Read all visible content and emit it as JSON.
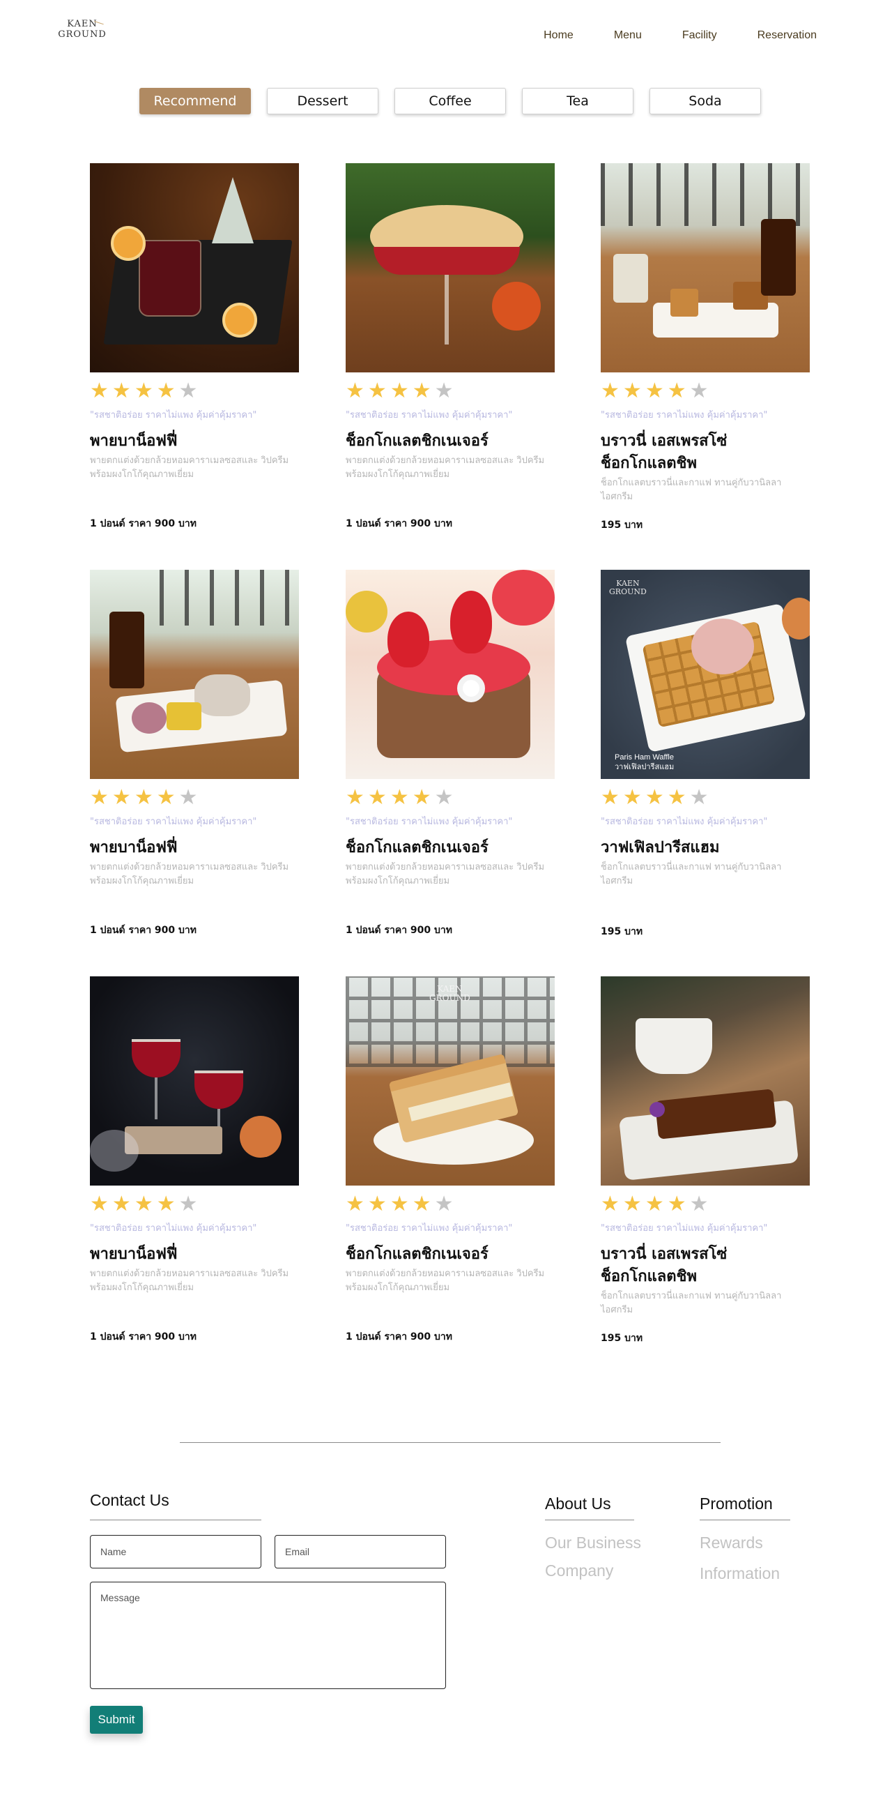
{
  "brand": {
    "line1": "KAEN",
    "line2": "GROUND"
  },
  "nav": [
    "Home",
    "Menu",
    "Facility",
    "Reservation"
  ],
  "tabs": [
    {
      "label": "Recommend",
      "active": true
    },
    {
      "label": "Dessert",
      "active": false
    },
    {
      "label": "Coffee",
      "active": false
    },
    {
      "label": "Tea",
      "active": false
    },
    {
      "label": "Soda",
      "active": false
    }
  ],
  "products": [
    {
      "rating": 4,
      "tagline": "\"รสชาติอร่อย ราคาไม่แพง คุ้มค่าคุ้มราคา\"",
      "name": "พายบาน็อฟฟี่",
      "desc": "พายตกแต่งด้วยกล้วยหอมคาราเมลซอสและ วิปครีม พร้อมผงโกโก้คุณภาพเยี่ยม",
      "price": "1 ปอนด์ ราคา 900 บาท"
    },
    {
      "rating": 4,
      "tagline": "\"รสชาติอร่อย ราคาไม่แพง คุ้มค่าคุ้มราคา\"",
      "name": "ช็อกโกแลตชิกเนเจอร์",
      "desc": "พายตกแต่งด้วยกล้วยหอมคาราเมลซอสและ วิปครีม พร้อมผงโกโก้คุณภาพเยี่ยม",
      "price": "1 ปอนด์ ราคา 900 บาท"
    },
    {
      "rating": 4,
      "tagline": "\"รสชาติอร่อย ราคาไม่แพง คุ้มค่าคุ้มราคา\"",
      "name": "บราวนี่ เอสเพรสโซ่ ช็อกโกแลตชิพ",
      "desc": "ช็อกโกแลตบราวนี่และกาแฟ ทานคู่กับวานิลลาไอศกรีม",
      "price": "195 บาท"
    },
    {
      "rating": 4,
      "tagline": "\"รสชาติอร่อย ราคาไม่แพง คุ้มค่าคุ้มราคา\"",
      "name": "พายบาน็อฟฟี่",
      "desc": "พายตกแต่งด้วยกล้วยหอมคาราเมลซอสและ วิปครีม พร้อมผงโกโก้คุณภาพเยี่ยม",
      "price": "1 ปอนด์ ราคา 900 บาท"
    },
    {
      "rating": 4,
      "tagline": "\"รสชาติอร่อย ราคาไม่แพง คุ้มค่าคุ้มราคา\"",
      "name": "ช็อกโกแลตชิกเนเจอร์",
      "desc": "พายตกแต่งด้วยกล้วยหอมคาราเมลซอสและ วิปครีม พร้อมผงโกโก้คุณภาพเยี่ยม",
      "price": "1 ปอนด์ ราคา 900 บาท"
    },
    {
      "rating": 4,
      "tagline": "\"รสชาติอร่อย ราคาไม่แพง คุ้มค่าคุ้มราคา\"",
      "name": "วาฟเฟิลปารีสแฮม",
      "desc": "ช็อกโกแลตบราวนี่และกาแฟ ทานคู่กับวานิลลาไอศกรีม",
      "price": "195 บาท",
      "photo_caption": "Paris Ham Waffle",
      "photo_caption_th": "วาฟเฟิลปารีสแฮม"
    },
    {
      "rating": 4,
      "tagline": "\"รสชาติอร่อย ราคาไม่แพง คุ้มค่าคุ้มราคา\"",
      "name": "พายบาน็อฟฟี่",
      "desc": "พายตกแต่งด้วยกล้วยหอมคาราเมลซอสและ วิปครีม พร้อมผงโกโก้คุณภาพเยี่ยม",
      "price": "1 ปอนด์ ราคา 900 บาท"
    },
    {
      "rating": 4,
      "tagline": "\"รสชาติอร่อย ราคาไม่แพง คุ้มค่าคุ้มราคา\"",
      "name": "ช็อกโกแลตชิกเนเจอร์",
      "desc": "พายตกแต่งด้วยกล้วยหอมคาราเมลซอสและ วิปครีม พร้อมผงโกโก้คุณภาพเยี่ยม",
      "price": "1 ปอนด์ ราคา 900 บาท"
    },
    {
      "rating": 4,
      "tagline": "\"รสชาติอร่อย ราคาไม่แพง คุ้มค่าคุ้มราคา\"",
      "name": "บราวนี่ เอสเพรสโซ่ ช็อกโกแลตชิพ",
      "desc": "ช็อกโกแลตบราวนี่และกาแฟ ทานคู่กับวานิลลาไอศกรีม",
      "price": "195 บาท"
    }
  ],
  "contact": {
    "title": "Contact Us",
    "name_placeholder": "Name",
    "email_placeholder": "Email",
    "message_placeholder": "Message",
    "submit_label": "Submit"
  },
  "about": {
    "title": "About Us",
    "links": [
      "Our Business",
      "Company"
    ]
  },
  "promotion": {
    "title": "Promotion",
    "links": [
      "Rewards",
      "Information"
    ]
  },
  "colors": {
    "accent": "#b08a62",
    "submit": "#127e77",
    "star_on": "#f5c242",
    "star_off": "#c4c4c4",
    "tagline": "#b8b8e0"
  }
}
